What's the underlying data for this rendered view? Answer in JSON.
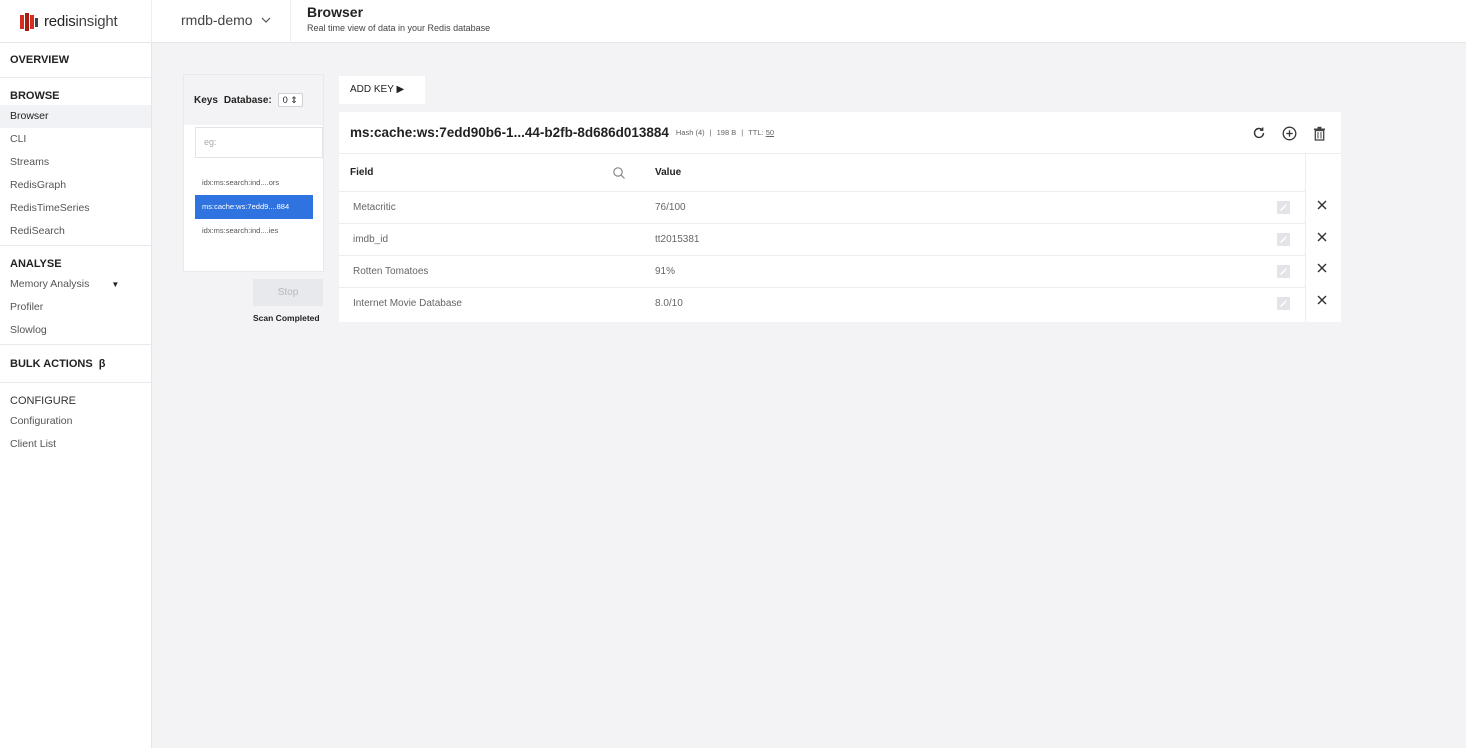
{
  "app": {
    "logo_brand": "redis",
    "logo_suffix": "insight",
    "database_name": "rmdb-demo",
    "page_title": "Browser",
    "page_subtitle": "Real time view of data in your Redis database",
    "brand_color": "#d82c20"
  },
  "sidebar": {
    "overview": "OVERVIEW",
    "browse": {
      "heading": "BROWSE",
      "items": [
        "Browser",
        "CLI",
        "Streams",
        "RedisGraph",
        "RedisTimeSeries",
        "RediSearch"
      ],
      "active": "Browser"
    },
    "analyse": {
      "heading": "ANALYSE",
      "items": [
        "Memory Analysis",
        "Profiler",
        "Slowlog"
      ]
    },
    "bulk_actions": "BULK ACTIONS",
    "bulk_beta": "β",
    "configure": {
      "heading": "CONFIGURE",
      "items": [
        "Configuration",
        "Client List"
      ]
    }
  },
  "keys_panel": {
    "keys_label": "Keys",
    "database_label": "Database:",
    "database_value": "0 ⇕",
    "search_placeholder": "eg:",
    "keys": [
      "idx:ms:search:ind....ors",
      "ms:cache:ws:7edd9....884",
      "idx:ms:search:ind....ies"
    ],
    "selected_index": 1,
    "stop_label": "Stop",
    "scan_status": "Scan Completed",
    "selected_color": "#2f73e0"
  },
  "detail": {
    "add_key_label": "ADD KEY ▶",
    "key_name": "ms:cache:ws:7edd90b6-1...44-b2fb-8d686d013884",
    "key_type": "Hash (4)",
    "key_size": "198 B",
    "ttl_label": "TTL:",
    "ttl_value": "50",
    "columns": {
      "field": "Field",
      "value": "Value"
    },
    "rows": [
      {
        "field": "Metacritic",
        "value": "76/100"
      },
      {
        "field": "imdb_id",
        "value": "tt2015381"
      },
      {
        "field": "Rotten Tomatoes",
        "value": "91%"
      },
      {
        "field": "Internet Movie Database",
        "value": "8.0/10"
      }
    ],
    "icons": [
      "refresh-icon",
      "add-circle-icon",
      "trash-icon",
      "search-icon",
      "edit-icon",
      "close-icon"
    ]
  }
}
